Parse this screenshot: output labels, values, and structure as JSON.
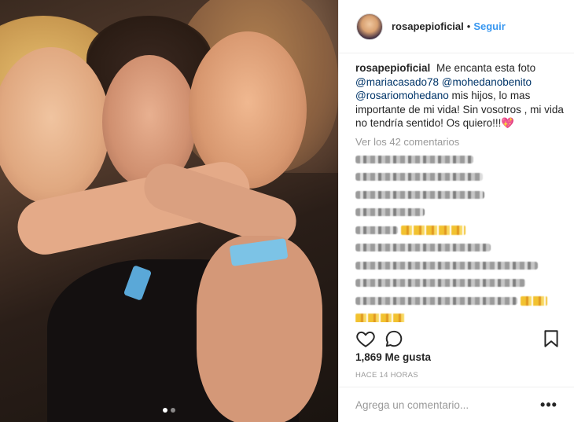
{
  "post": {
    "username": "rosapepioficial",
    "separator": "•",
    "follow_label": "Seguir",
    "caption": {
      "username": "rosapepioficial",
      "text_1": "Me encanta esta foto",
      "mention_1": "@mariacasado78",
      "mention_2": "@mohedanobenito",
      "mention_3": "@rosariomohedano",
      "text_2": "mis hijos, lo mas importante de mi vida! Sin vosotros , mi vida no tendría sentido! Os quiero!!!",
      "heart": "💖"
    },
    "view_all_comments": "Ver los 42 comentarios",
    "likes": "1,869 Me gusta",
    "timestamp": "HACE 14 HORAS",
    "add_comment_placeholder": "Agrega un comentario...",
    "more_options": "•••",
    "carousel": {
      "total": 2,
      "active": 1
    }
  },
  "icons": {
    "like": "heart-outline-icon",
    "comment": "comment-bubble-icon",
    "save": "bookmark-icon"
  },
  "colors": {
    "follow": "#3897f0",
    "mention": "#003569",
    "muted": "#999999",
    "text": "#262626"
  }
}
